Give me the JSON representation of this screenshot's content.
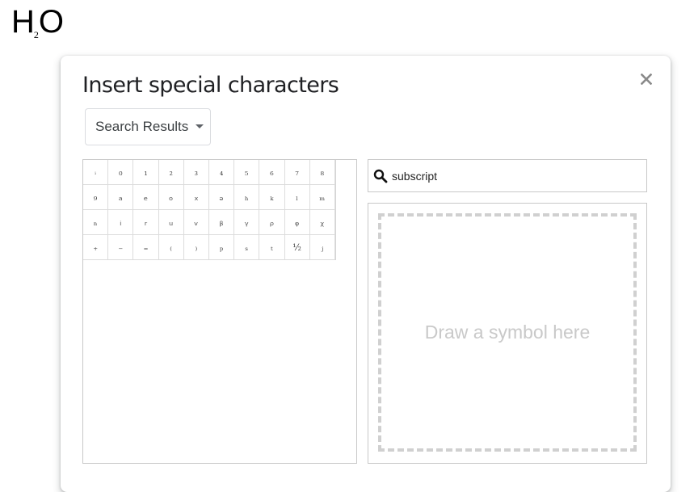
{
  "document": {
    "text_before": "H",
    "subscript": "2",
    "text_after": "O"
  },
  "dialog": {
    "title": "Insert special characters",
    "close_icon": "close-icon",
    "category_dropdown": {
      "selected": "Search Results",
      "icon": "caret-down-icon"
    },
    "search": {
      "icon": "search-icon",
      "value": "subscript",
      "placeholder": ""
    },
    "draw_area": {
      "hint": "Draw a symbol here"
    },
    "characters": [
      "ᵢ",
      "₀",
      "₁",
      "₂",
      "₃",
      "₄",
      "₅",
      "₆",
      "₇",
      "₈",
      "₉",
      "ₐ",
      "ₑ",
      "ₒ",
      "ₓ",
      "ₔ",
      "ₕ",
      "ₖ",
      "ₗ",
      "ₘ",
      "ₙ",
      "ᵢ",
      "ᵣ",
      "ᵤ",
      "ᵥ",
      "ᵦ",
      "ᵧ",
      "ᵨ",
      "ᵩ",
      "ᵪ",
      "₊",
      "₋",
      "₌",
      "₍",
      "₎",
      "ₚ",
      "ₛ",
      "ₜ",
      "⅟₂",
      "ⱼ"
    ]
  }
}
